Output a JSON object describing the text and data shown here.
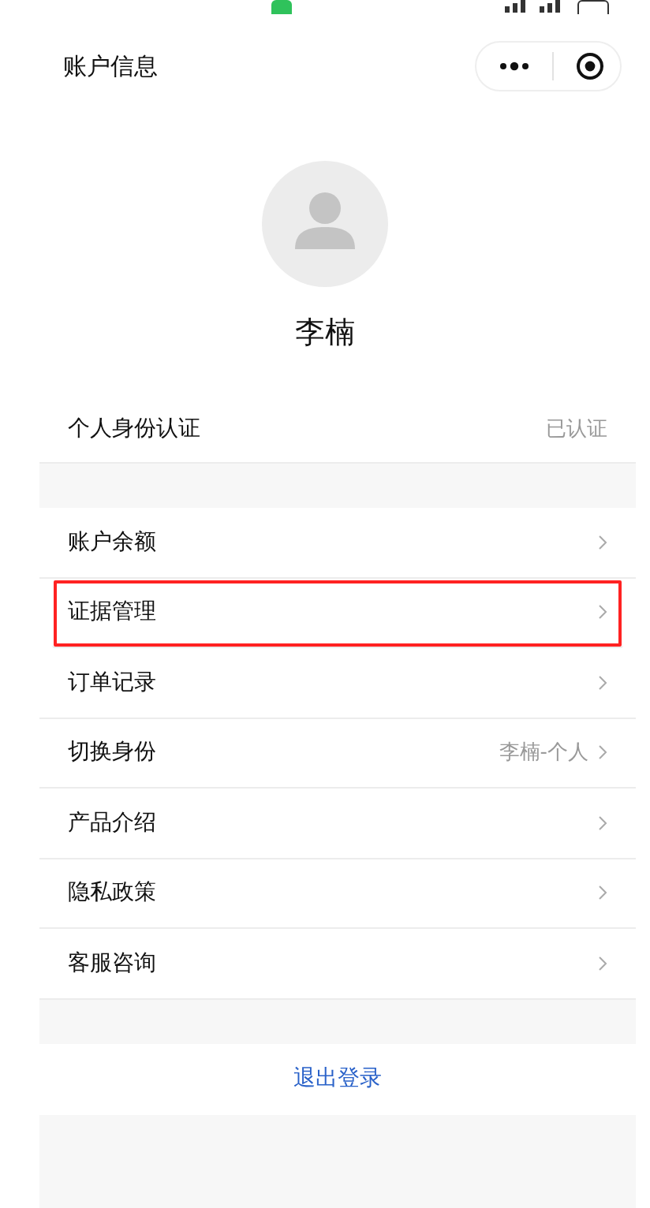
{
  "header": {
    "title": "账户信息"
  },
  "profile": {
    "name": "李楠"
  },
  "verification": {
    "label": "个人身份认证",
    "value": "已认证"
  },
  "menu": [
    {
      "label": "账户余额",
      "highlighted": false
    },
    {
      "label": "证据管理",
      "highlighted": true
    },
    {
      "label": "订单记录",
      "highlighted": false
    },
    {
      "label": "切换身份",
      "value": "李楠-个人",
      "highlighted": false
    },
    {
      "label": "产品介绍",
      "highlighted": false
    },
    {
      "label": "隐私政策",
      "highlighted": false
    },
    {
      "label": "客服咨询",
      "highlighted": false
    }
  ],
  "logout": {
    "label": "退出登录"
  }
}
